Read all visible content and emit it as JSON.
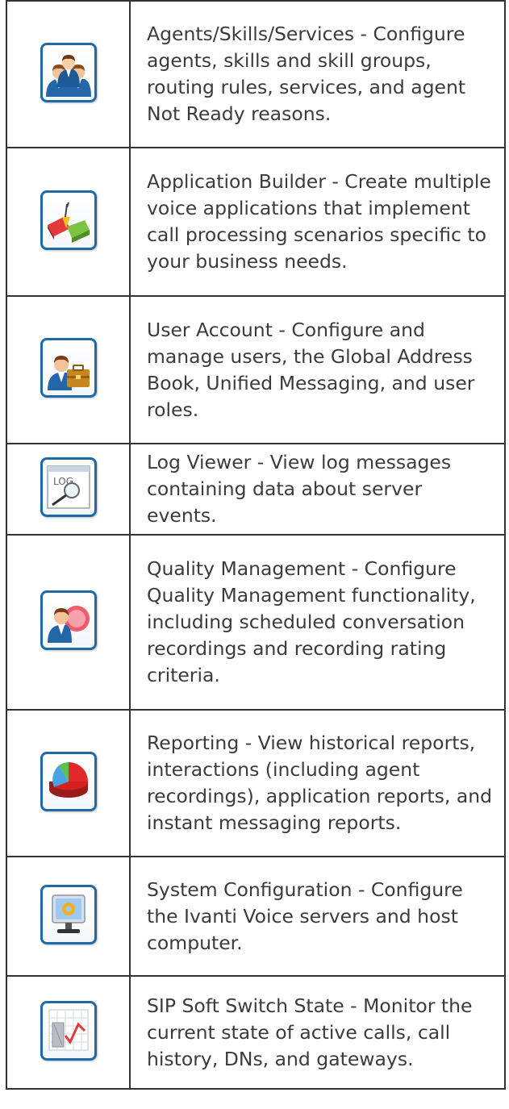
{
  "rows": [
    {
      "icon": "agents-icon",
      "text": "Agents/Skills/Services - Configure agents, skills and skill groups, routing rules, services, and agent Not Ready reasons."
    },
    {
      "icon": "application-builder-icon",
      "text": "Application Builder - Create multiple voice applications that implement call processing scenarios specific to your business needs."
    },
    {
      "icon": "user-account-icon",
      "text": "User Account - Configure and manage users, the Global Address Book, Unified Messaging, and user roles."
    },
    {
      "icon": "log-viewer-icon",
      "text": "Log Viewer - View log messages containing data about server events."
    },
    {
      "icon": "quality-management-icon",
      "text": "Quality Management - Configure Quality Management functionality, including scheduled conversation recordings and recording rating criteria."
    },
    {
      "icon": "reporting-icon",
      "text": "Reporting - View historical reports, interactions (including agent recordings), application reports, and instant messaging reports."
    },
    {
      "icon": "system-configuration-icon",
      "text": "System Configuration - Configure the Ivanti Voice servers and host computer."
    },
    {
      "icon": "sip-soft-switch-icon",
      "text": "SIP Soft Switch State - Monitor the current state of active calls, call history, DNs, and gateways."
    }
  ]
}
